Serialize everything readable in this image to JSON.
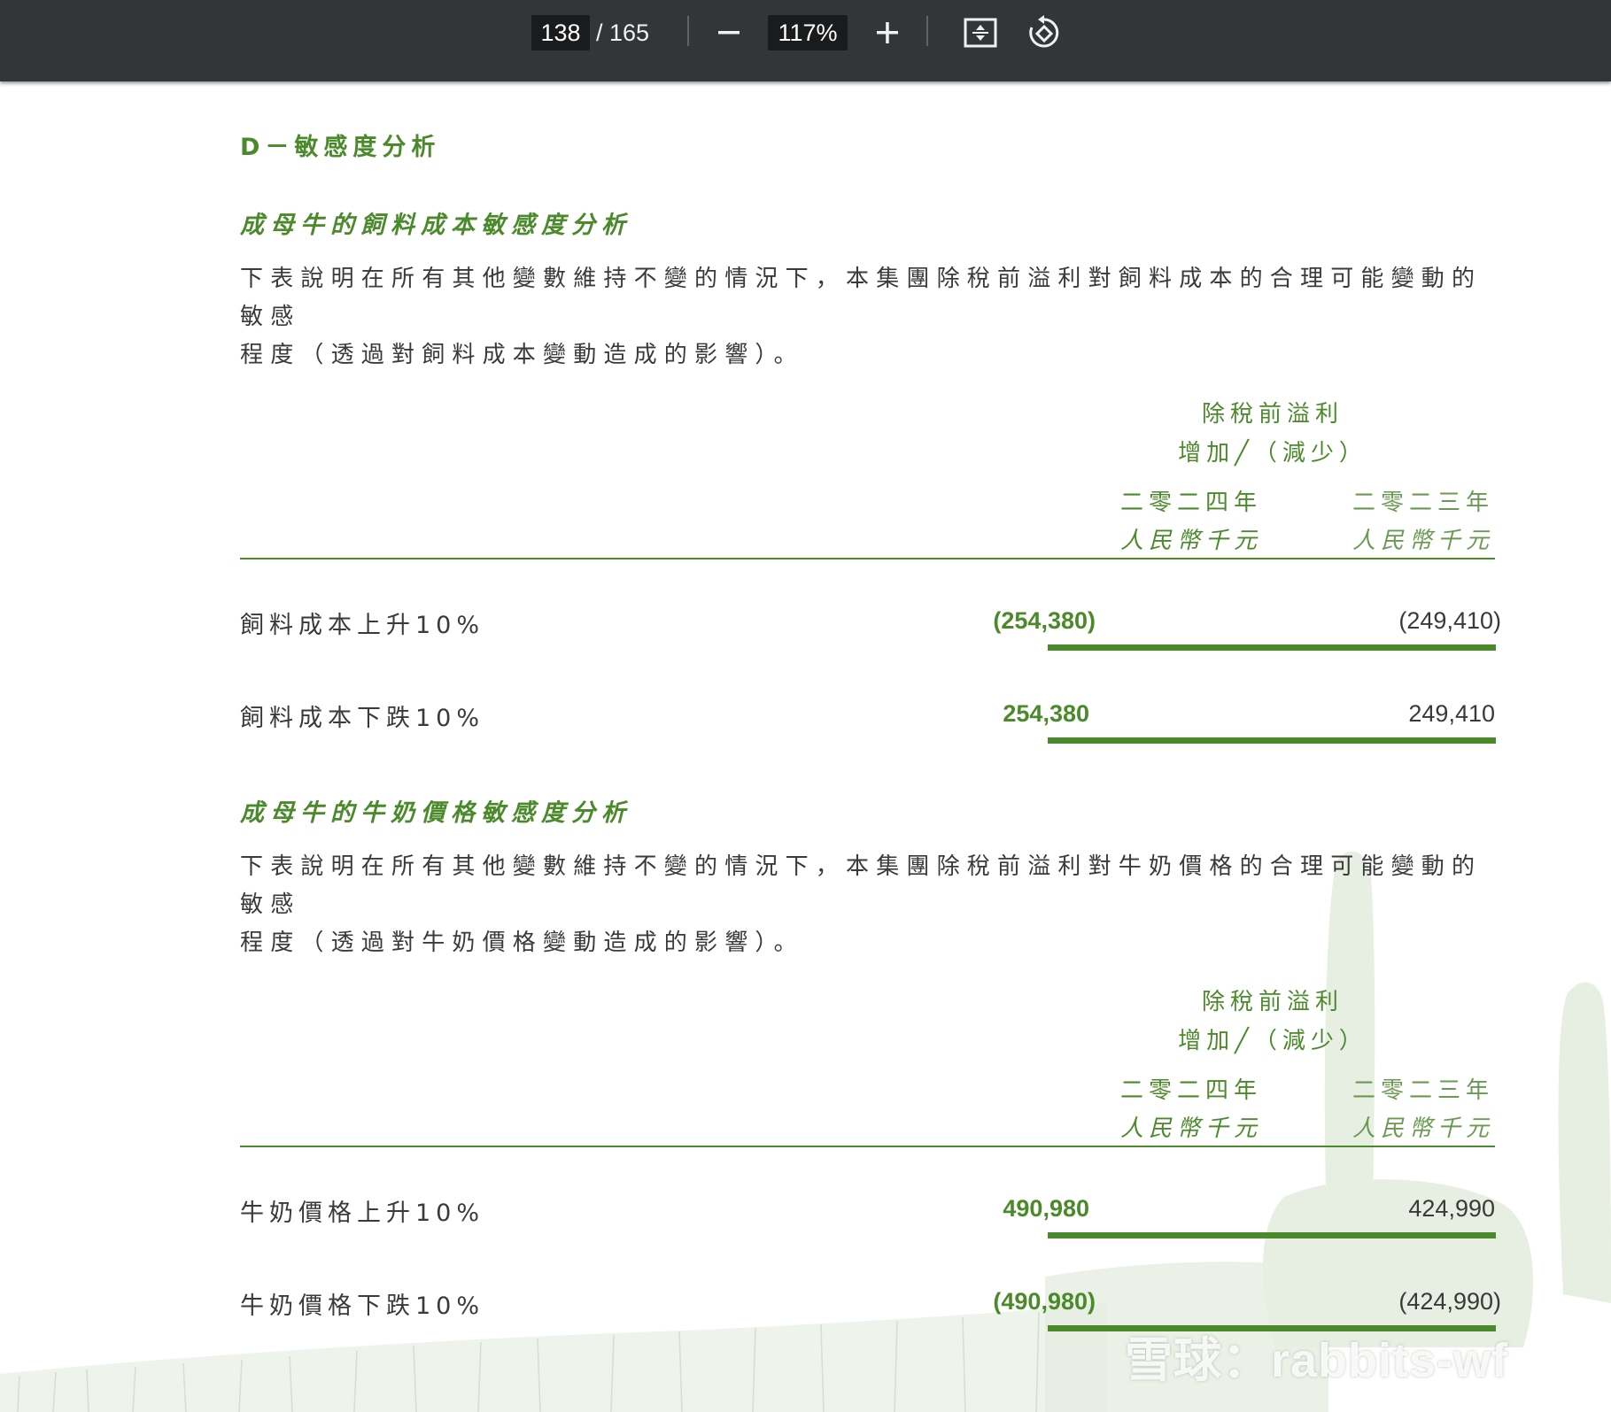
{
  "toolbar": {
    "current_page": "138",
    "total_pages": "/ 165",
    "zoom": "117%",
    "icons": [
      "minus-icon",
      "plus-icon",
      "fit-page-icon",
      "rotate-icon"
    ]
  },
  "document": {
    "section_title": "D－敏感度分析",
    "part1": {
      "title": "成母牛的飼料成本敏感度分析",
      "para_line1": "下表說明在所有其他變數維持不變的情況下，本集團除稅前溢利對飼料成本的合理可能變動的敏感",
      "para_line2": "程度（透過對飼料成本變動造成的影響）。",
      "header_line1": "除稅前溢利",
      "header_line2": "增加╱（減少）",
      "col2024_year": "二零二四年",
      "col2024_unit": "人民幣千元",
      "col2023_year": "二零二三年",
      "col2023_unit": "人民幣千元",
      "rows": [
        {
          "label": "飼料成本上升10%",
          "v2024": "(254,380)",
          "v2023": "(249,410)"
        },
        {
          "label": "飼料成本下跌10%",
          "v2024": "254,380",
          "v2023": "249,410"
        }
      ]
    },
    "part2": {
      "title": "成母牛的牛奶價格敏感度分析",
      "para_line1": "下表說明在所有其他變數維持不變的情況下，本集團除稅前溢利對牛奶價格的合理可能變動的敏感",
      "para_line2": "程度（透過對牛奶價格變動造成的影響）。",
      "header_line1": "除稅前溢利",
      "header_line2": "增加╱（減少）",
      "col2024_year": "二零二四年",
      "col2024_unit": "人民幣千元",
      "col2023_year": "二零二三年",
      "col2023_unit": "人民幣千元",
      "rows": [
        {
          "label": "牛奶價格上升10%",
          "v2024": "490,980",
          "v2023": "424,990"
        },
        {
          "label": "牛奶價格下跌10%",
          "v2024": "(490,980)",
          "v2023": "(424,990)"
        }
      ]
    }
  },
  "watermark": "雪球：rabbits-wf",
  "colors": {
    "accent_green": "#4b8a2b",
    "toolbar_bg": "#323639"
  }
}
